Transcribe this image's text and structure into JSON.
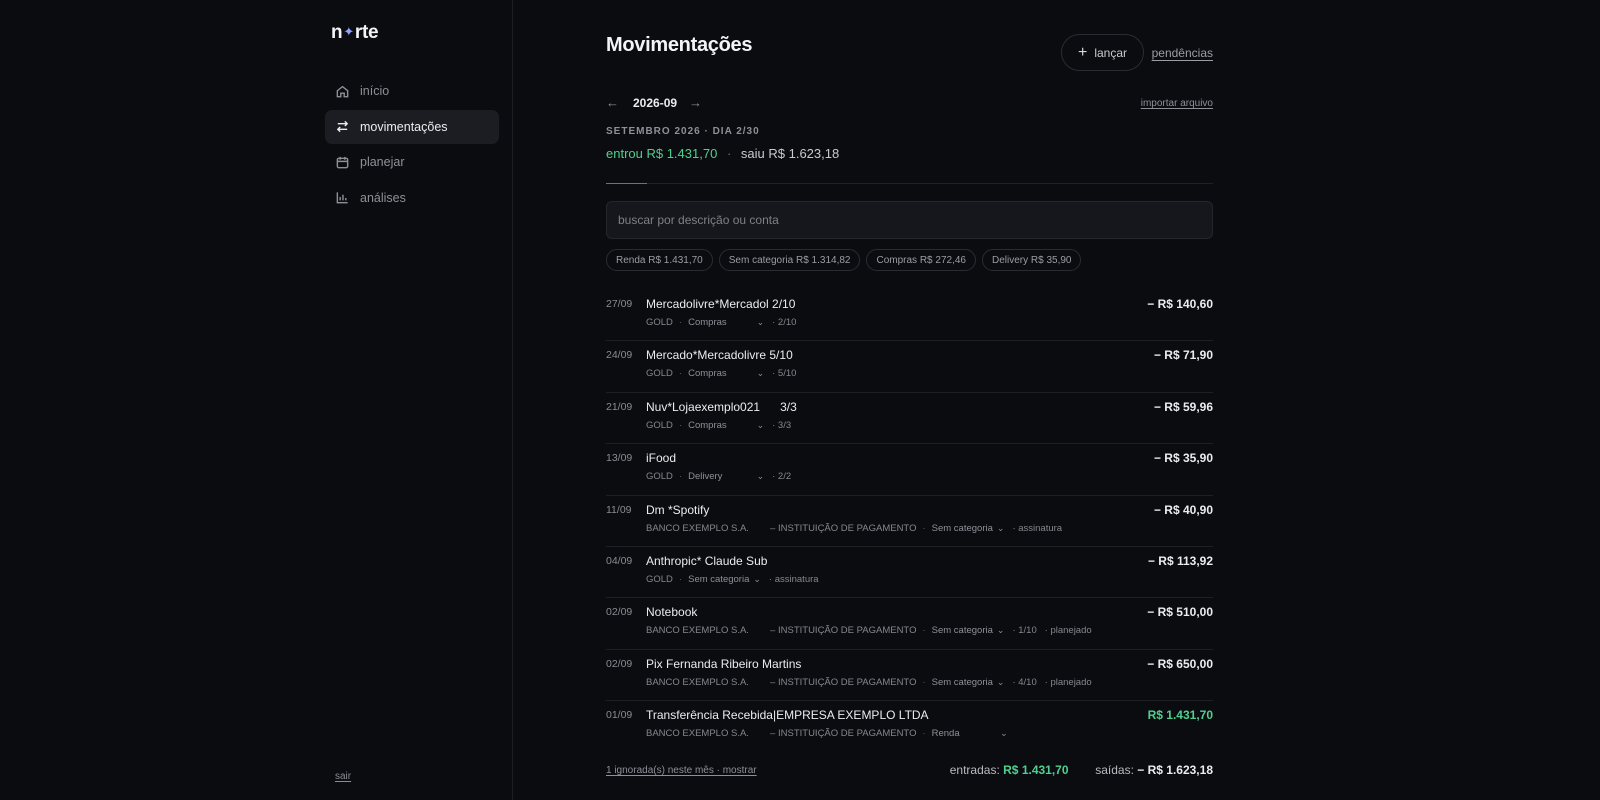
{
  "app": {
    "logo": {
      "prefix": "n",
      "star": "✦",
      "suffix": "rte"
    }
  },
  "sidebar": {
    "items": [
      {
        "label": "início",
        "icon": "home-icon",
        "active": false
      },
      {
        "label": "movimentações",
        "icon": "arrows-exchange-icon",
        "active": true
      },
      {
        "label": "planejar",
        "icon": "calendar-icon",
        "active": false
      },
      {
        "label": "análises",
        "icon": "bar-chart-icon",
        "active": false
      }
    ],
    "logout": "sair"
  },
  "header": {
    "title": "Movimentações",
    "launch_button": "lançar",
    "pending_link": "pendências"
  },
  "month_nav": {
    "prev": "←",
    "month": "2026-09",
    "next": "→",
    "import_link": "importar arquivo",
    "caption": "SETEMBRO 2026 · DIA 2/30"
  },
  "summary": {
    "in_label": "entrou R$ 1.431,70",
    "dot": "·",
    "out_label": "saiu R$ 1.623,18"
  },
  "search": {
    "placeholder": "buscar por descrição ou conta",
    "value": ""
  },
  "chips": [
    "Renda R$ 1.431,70",
    "Sem categoria R$ 1.314,82",
    "Compras R$ 272,46",
    "Delivery R$ 35,90"
  ],
  "transactions": [
    {
      "date": "27/09",
      "description": "Mercadolivre*Mercadol 2/10",
      "account": "GOLD",
      "category": "Compras",
      "extra": "· 2/10",
      "amount": "− R$ 140,60",
      "positive": false
    },
    {
      "date": "24/09",
      "description": "Mercado*Mercadolivre 5/10",
      "account": "GOLD",
      "category": "Compras",
      "extra": "· 5/10",
      "amount": "− R$ 71,90",
      "positive": false
    },
    {
      "date": "21/09",
      "description": "Nuv*Lojaexemplo021      3/3",
      "account": "GOLD",
      "category": "Compras",
      "extra": "· 3/3",
      "amount": "− R$ 59,96",
      "positive": false
    },
    {
      "date": "13/09",
      "description": "iFood",
      "account": "GOLD",
      "category": "Delivery",
      "extra": "· 2/2",
      "amount": "− R$ 35,90",
      "positive": false
    },
    {
      "date": "11/09",
      "description": "Dm *Spotify",
      "account": "BANCO EXEMPLO S.A.        – INSTITUIÇÃO DE PAGAMENTO",
      "category": "Sem categoria",
      "extra": "· assinatura",
      "amount": "− R$ 40,90",
      "positive": false
    },
    {
      "date": "04/09",
      "description": "Anthropic* Claude Sub",
      "account": "GOLD",
      "category": "Sem categoria",
      "extra": "· assinatura",
      "amount": "− R$ 113,92",
      "positive": false
    },
    {
      "date": "02/09",
      "description": "Notebook",
      "account": "BANCO EXEMPLO S.A.        – INSTITUIÇÃO DE PAGAMENTO",
      "category": "Sem categoria",
      "extra": "· 1/10   · planejado",
      "amount": "− R$ 510,00",
      "positive": false
    },
    {
      "date": "02/09",
      "description": "Pix Fernanda Ribeiro Martins",
      "account": "BANCO EXEMPLO S.A.        – INSTITUIÇÃO DE PAGAMENTO",
      "category": "Sem categoria",
      "extra": "· 4/10   · planejado",
      "amount": "− R$ 650,00",
      "positive": false
    },
    {
      "date": "01/09",
      "description": "Transferência Recebida|EMPRESA EXEMPLO LTDA",
      "account": "BANCO EXEMPLO S.A.        – INSTITUIÇÃO DE PAGAMENTO",
      "category": "Renda",
      "extra": "",
      "amount": "R$ 1.431,70",
      "positive": true
    }
  ],
  "footer": {
    "ignored_link": "1 ignorada(s) neste mês · mostrar",
    "in_label": "entradas:",
    "in_value": "R$ 1.431,70",
    "out_label": "saídas:",
    "out_value": "− R$ 1.623,18"
  },
  "colors": {
    "background": "#0b0c10",
    "positive": "#4fd08f",
    "active_nav": "#1c1d22",
    "logo_star": "#8fa4ff"
  }
}
